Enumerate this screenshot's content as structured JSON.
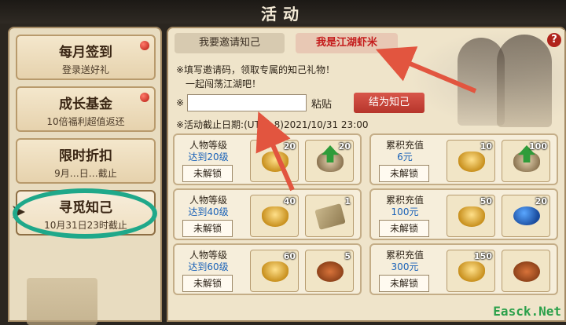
{
  "header": {
    "title": "活动"
  },
  "sidebar": {
    "items": [
      {
        "title": "每月签到",
        "subtitle": "登录送好礼",
        "badge": true
      },
      {
        "title": "成长基金",
        "subtitle": "10倍福利超值返还",
        "badge": true
      },
      {
        "title": "限时折扣",
        "subtitle": "9月…日…截止",
        "badge": false
      },
      {
        "title": "寻觅知己",
        "subtitle": "10月31日23时截止",
        "badge": false,
        "active": true
      }
    ]
  },
  "main": {
    "tabs": [
      {
        "label": "我要邀请知己"
      },
      {
        "label": "我是江湖虾米"
      }
    ],
    "help_label": "?",
    "info_line1": "※填写邀请码，领取专属的知己礼物！",
    "info_line2": "一起闯荡江湖吧！",
    "input_prefix": "※",
    "input_value": "",
    "paste_label": "粘贴",
    "bind_button": "结为知己",
    "deadline": "※活动截止日期:(UTC+8)2021/10/31 23:00",
    "cards_left": [
      {
        "label1": "人物等级",
        "label2": "达到20级",
        "lock": "未解锁",
        "items": [
          {
            "icon": "gold-ingot",
            "count": "20"
          },
          {
            "icon": "exp-bag",
            "count": "20"
          }
        ]
      },
      {
        "label1": "人物等级",
        "label2": "达到40级",
        "lock": "未解锁",
        "items": [
          {
            "icon": "gold-ingot",
            "count": "40"
          },
          {
            "icon": "scroll",
            "count": "1"
          }
        ]
      },
      {
        "label1": "人物等级",
        "label2": "达到60级",
        "lock": "未解锁",
        "items": [
          {
            "icon": "gold-ingot",
            "count": "60"
          },
          {
            "icon": "pastry",
            "count": "5"
          }
        ]
      }
    ],
    "cards_right": [
      {
        "label1": "累积充值",
        "label2": "6元",
        "lock": "未解锁",
        "items": [
          {
            "icon": "gold-ingot",
            "count": "10"
          },
          {
            "icon": "exp-bag",
            "count": "100"
          }
        ]
      },
      {
        "label1": "累积充值",
        "label2": "100元",
        "lock": "未解锁",
        "items": [
          {
            "icon": "gold-ingot",
            "count": "50"
          },
          {
            "icon": "blue-orb",
            "count": "20"
          }
        ]
      },
      {
        "label1": "累积充值",
        "label2": "300元",
        "lock": "未解锁",
        "items": [
          {
            "icon": "gold-ingot",
            "count": "150"
          },
          {
            "icon": "pastry",
            "count": ""
          }
        ]
      }
    ]
  },
  "watermark": "Easck.Net",
  "colors": {
    "accent_red": "#b6352b",
    "annotation_arrow": "#e2553f",
    "annotation_ring": "#1fa88a",
    "level_text": "#1a62b8"
  }
}
